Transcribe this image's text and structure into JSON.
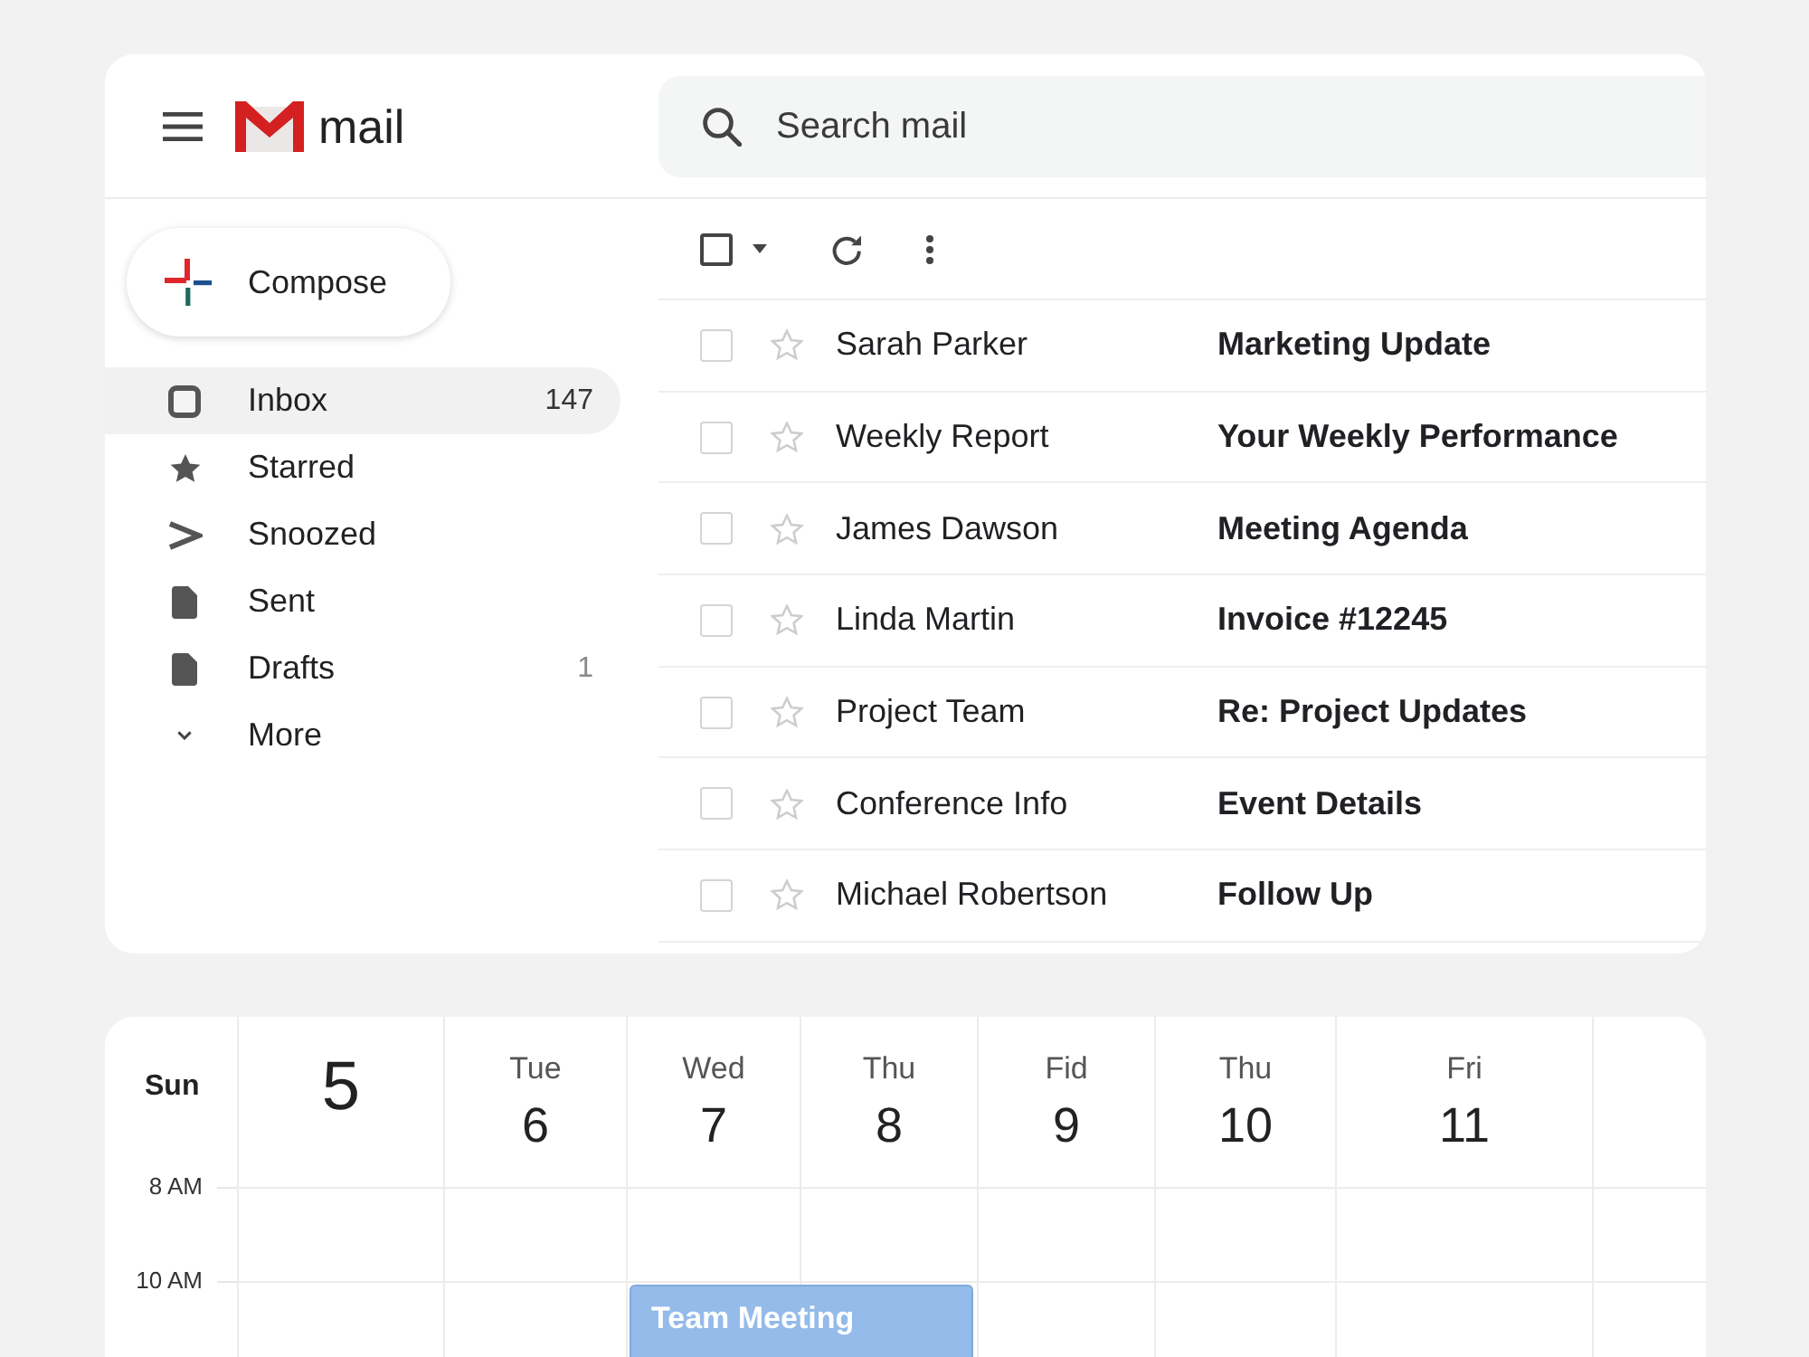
{
  "header": {
    "app_name": "mail",
    "search": {
      "placeholder": "Search mail"
    }
  },
  "compose": {
    "label": "Compose"
  },
  "sidebar": {
    "items": [
      {
        "label": "Inbox",
        "count": "147",
        "selected": true
      },
      {
        "label": "Starred",
        "selected": false
      },
      {
        "label": "Snoozed",
        "selected": false
      },
      {
        "label": "Sent",
        "selected": false
      },
      {
        "label": "Drafts",
        "count": "1",
        "selected": false
      },
      {
        "label": "More",
        "selected": false
      }
    ]
  },
  "toolbar": {
    "select_all": {
      "checked": false
    }
  },
  "emails": [
    {
      "sender": "Sarah Parker",
      "subject": "Marketing Update",
      "checked": false,
      "starred": false
    },
    {
      "sender": "Weekly Report",
      "subject": "Your Weekly Performance",
      "checked": false,
      "starred": false
    },
    {
      "sender": "James Dawson",
      "subject": "Meeting Agenda",
      "checked": false,
      "starred": false
    },
    {
      "sender": "Linda Martin",
      "subject": "Invoice #12245",
      "checked": false,
      "starred": false
    },
    {
      "sender": "Project Team",
      "subject": "Re: Project Updates",
      "checked": false,
      "starred": false
    },
    {
      "sender": "Conference Info",
      "subject": "Event Details",
      "checked": false,
      "starred": false
    },
    {
      "sender": "Michael Robertson",
      "subject": "Follow Up",
      "checked": false,
      "starred": false
    }
  ],
  "calendar": {
    "gutter_label": "Sun",
    "times": [
      "8 AM",
      "10 AM"
    ],
    "days": [
      {
        "number": "5",
        "today": true
      },
      {
        "name": "Tue",
        "number": "6",
        "today": false
      },
      {
        "name": "Wed",
        "number": "7",
        "today": false,
        "events": [
          {
            "title": "Team Meeting"
          }
        ]
      },
      {
        "name": "Thu",
        "number": "8",
        "today": false
      },
      {
        "name": "Fid",
        "number": "9",
        "today": false
      },
      {
        "name": "Thu",
        "number": "10",
        "today": false
      },
      {
        "name": "Fri",
        "number": "11",
        "today": false
      }
    ]
  }
}
